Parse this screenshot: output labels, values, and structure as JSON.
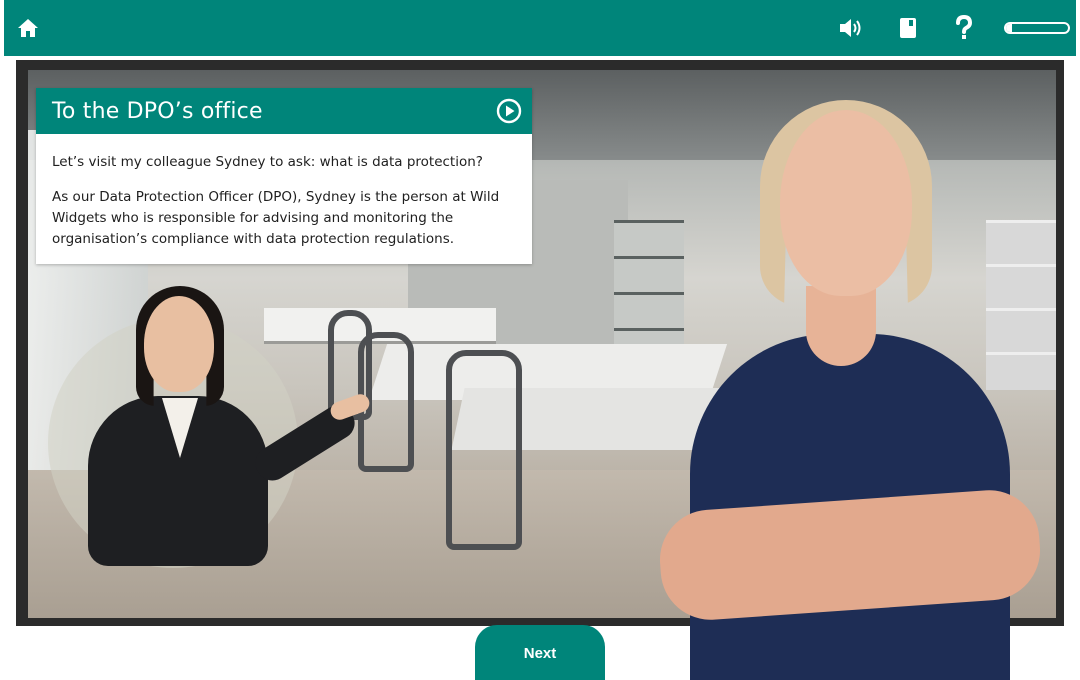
{
  "topbar": {
    "icons": {
      "home": "home-icon",
      "sound": "speaker-icon",
      "glossary": "book-icon",
      "help": "question-icon"
    },
    "progress_fraction": 0.1
  },
  "card": {
    "title": "To the DPO’s office",
    "paragraph1": "Let’s visit my colleague Sydney to ask: what is data protection?",
    "paragraph2": "As our Data Protection Officer (DPO), Sydney is the person at Wild Widgets who is responsible for advising and monitoring the organisation’s compliance with data protection regulations."
  },
  "next_button": {
    "label": "Next"
  },
  "colors": {
    "accent": "#00857a"
  }
}
